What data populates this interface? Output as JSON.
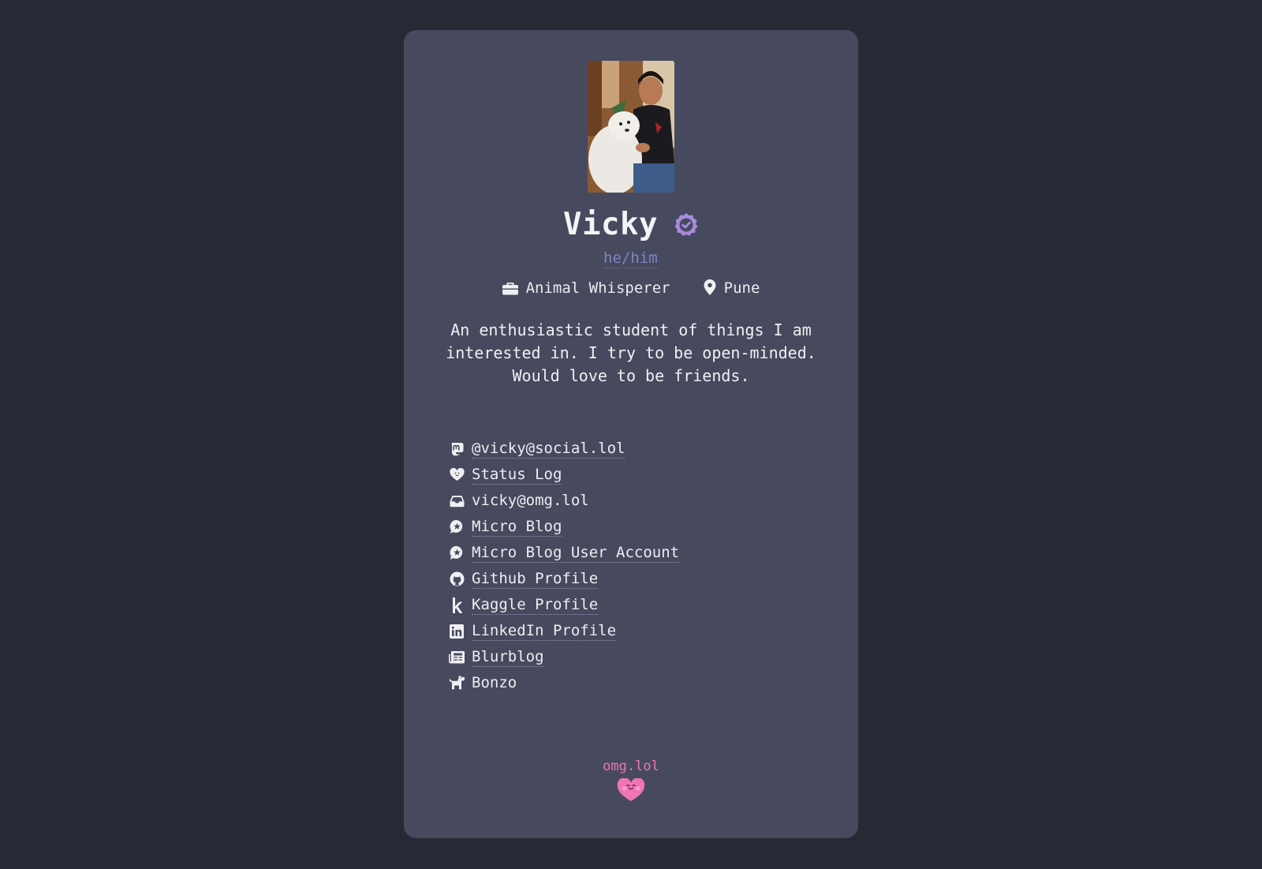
{
  "profile": {
    "name": "Vicky",
    "pronouns": "he/him",
    "occupation": "Animal Whisperer",
    "location": "Pune",
    "bio": "An enthusiastic student of things I am interested in. I try to be open-minded. Would love to be friends."
  },
  "links": [
    {
      "label": "@vicky@social.lol",
      "icon": "mastodon-icon"
    },
    {
      "label": "Status Log",
      "icon": "heart-face-icon"
    },
    {
      "label": "vicky@omg.lol",
      "icon": "inbox-icon"
    },
    {
      "label": "Micro Blog",
      "icon": "star-bubble-icon"
    },
    {
      "label": "Micro Blog User Account",
      "icon": "star-bubble-icon"
    },
    {
      "label": "Github Profile",
      "icon": "github-icon"
    },
    {
      "label": "Kaggle Profile",
      "icon": "kaggle-icon"
    },
    {
      "label": "LinkedIn Profile",
      "icon": "linkedin-icon"
    },
    {
      "label": "Blurblog",
      "icon": "newspaper-icon"
    },
    {
      "label": "Bonzo",
      "icon": "dog-icon"
    }
  ],
  "footer": {
    "link_text": "omg.lol",
    "icon": "omg-heart-icon"
  },
  "colors": {
    "page_background": "#272935",
    "card_background": "#474a5e",
    "pronoun_color": "#7c86c4",
    "verified_badge": "#a78bde",
    "brand_pink": "#f075b5"
  }
}
